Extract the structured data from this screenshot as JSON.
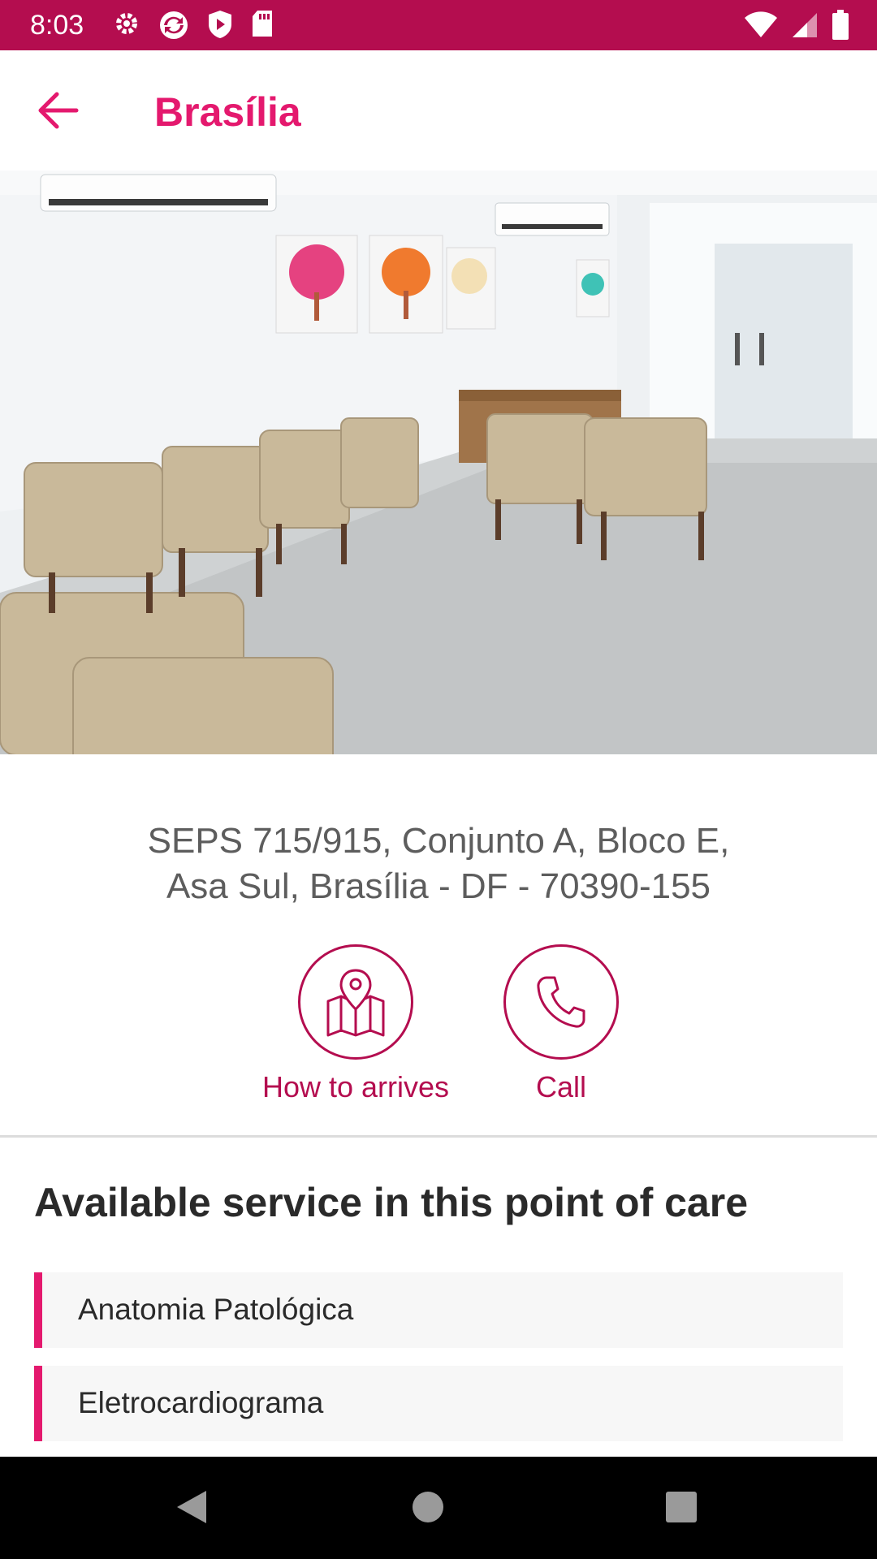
{
  "status_bar": {
    "time": "8:03",
    "left_icons": [
      "gear-icon",
      "sync-icon",
      "shield-play-icon",
      "sd-card-icon"
    ],
    "right_icons": [
      "wifi-icon",
      "signal-icon",
      "battery-icon"
    ]
  },
  "app_bar": {
    "title": "Brasília",
    "back_icon": "arrow-left-icon"
  },
  "colors": {
    "status_bar": "#b40d4f",
    "accent": "#e4196e",
    "action": "#b40d4f"
  },
  "address": {
    "line1": "SEPS 715/915, Conjunto A, Bloco E,",
    "line2": "Asa Sul, Brasília - DF - 70390-155"
  },
  "actions": {
    "arrive_label": "How to arrives",
    "arrive_icon": "map-pin-icon",
    "call_label": "Call",
    "call_icon": "phone-icon"
  },
  "services": {
    "title": "Available service in this point of care",
    "items": [
      "Anatomia Patológica",
      "Eletrocardiograma"
    ]
  },
  "nav_bar": {
    "icons": [
      "back-triangle-icon",
      "home-circle-icon",
      "recents-square-icon"
    ]
  }
}
